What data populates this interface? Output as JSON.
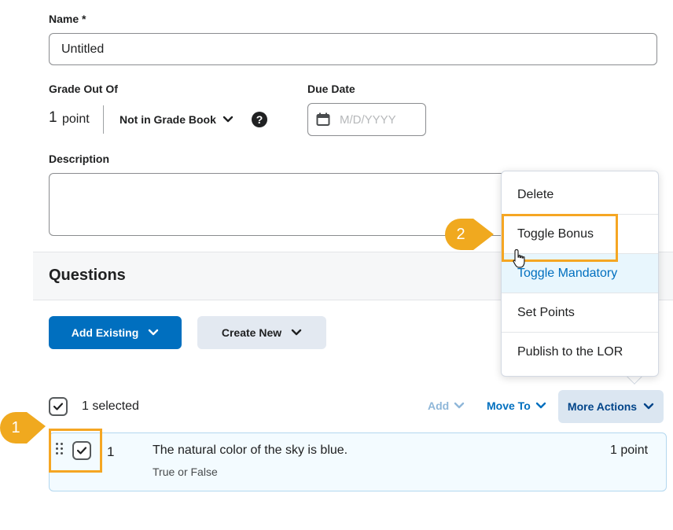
{
  "form": {
    "name_label": "Name *",
    "name_value": "Untitled",
    "grade_label": "Grade Out Of",
    "points_value": "1",
    "points_unit": "point",
    "gradebook_label": "Not in Grade Book",
    "help_glyph": "?",
    "due_label": "Due Date",
    "due_placeholder": "M/D/YYYY",
    "description_label": "Description"
  },
  "questions": {
    "title": "Questions",
    "add_existing": "Add Existing",
    "create_new": "Create New",
    "selected_text": "1 selected",
    "toolbar": {
      "add": "Add",
      "move_to": "Move To",
      "more_actions": "More Actions"
    },
    "rows": [
      {
        "number": "1",
        "text": "The natural color of the sky is blue.",
        "type": "True or False",
        "points": "1 point"
      }
    ]
  },
  "more_actions_menu": {
    "items": [
      "Delete",
      "Toggle Bonus",
      "Toggle Mandatory",
      "Set Points",
      "Publish to the LOR"
    ],
    "hovered_item": "Toggle Mandatory"
  },
  "callouts": [
    "1",
    "2"
  ],
  "colors": {
    "primary": "#006fbf",
    "highlight": "#f5a623",
    "callout": "#f0a91f"
  },
  "icons": [
    "calendar-icon",
    "help-icon",
    "chevron-down-icon",
    "checkmark-icon",
    "drag-handle-icon",
    "cursor-hand-icon"
  ]
}
